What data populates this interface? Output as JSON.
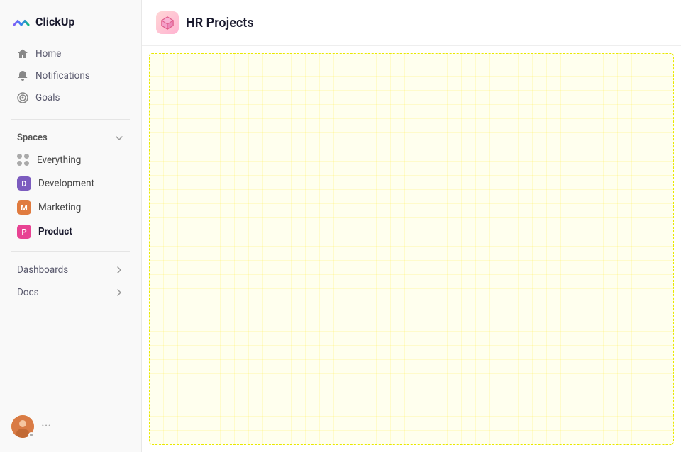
{
  "sidebar": {
    "logo": {
      "text": "ClickUp"
    },
    "nav": [
      {
        "id": "home",
        "label": "Home",
        "icon": "home-icon"
      },
      {
        "id": "notifications",
        "label": "Notifications",
        "icon": "bell-icon"
      },
      {
        "id": "goals",
        "label": "Goals",
        "icon": "target-icon"
      }
    ],
    "spaces_label": "Spaces",
    "spaces": [
      {
        "id": "everything",
        "label": "Everything",
        "type": "dots"
      },
      {
        "id": "development",
        "label": "Development",
        "type": "avatar",
        "letter": "D",
        "color": "#7c5cbf"
      },
      {
        "id": "marketing",
        "label": "Marketing",
        "type": "avatar",
        "letter": "M",
        "color": "#e07b3f"
      },
      {
        "id": "product",
        "label": "Product",
        "type": "avatar",
        "letter": "P",
        "color": "#e84393",
        "active": true
      }
    ],
    "expandable": [
      {
        "id": "dashboards",
        "label": "Dashboards"
      },
      {
        "id": "docs",
        "label": "Docs"
      }
    ]
  },
  "main": {
    "header": {
      "title": "HR Projects",
      "icon": "📦"
    }
  }
}
